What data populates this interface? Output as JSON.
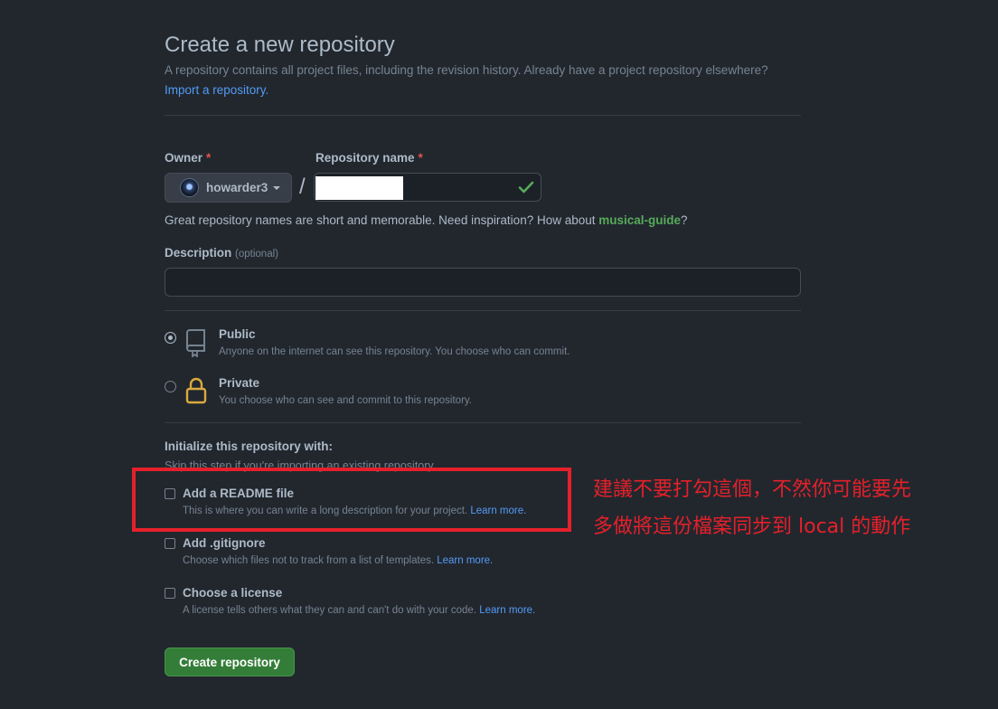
{
  "header": {
    "title": "Create a new repository",
    "subtitle": "A repository contains all project files, including the revision history. Already have a project repository elsewhere?",
    "import_link": "Import a repository."
  },
  "owner": {
    "label": "Owner",
    "required_mark": "*",
    "value": "howarder3"
  },
  "repo_name": {
    "label": "Repository name",
    "required_mark": "*",
    "separator": "/",
    "hint_prefix": "Great repository names are short and memorable. Need inspiration? How about ",
    "suggestion": "musical-guide",
    "hint_suffix": "?"
  },
  "description": {
    "label": "Description",
    "optional": "(optional)",
    "value": ""
  },
  "visibility": {
    "selected": "public",
    "options": [
      {
        "title": "Public",
        "desc": "Anyone on the internet can see this repository. You choose who can commit."
      },
      {
        "title": "Private",
        "desc": "You choose who can see and commit to this repository."
      }
    ]
  },
  "init": {
    "heading": "Initialize this repository with:",
    "subheading": "Skip this step if you're importing an existing repository.",
    "options": [
      {
        "title": "Add a README file",
        "desc": "This is where you can write a long description for your project.",
        "link": "Learn more."
      },
      {
        "title": "Add .gitignore",
        "desc": "Choose which files not to track from a list of templates.",
        "link": "Learn more."
      },
      {
        "title": "Choose a license",
        "desc": "A license tells others what they can and can't do with your code.",
        "link": "Learn more."
      }
    ]
  },
  "create_button": "Create repository",
  "annotation": {
    "line1": "建議不要打勾這個，不然你可能要先",
    "line2": "多做將這份檔案同步到 local 的動作"
  },
  "colors": {
    "background": "#22272e",
    "accent_green": "#347d39",
    "link_blue": "#539bf5",
    "annotation_red": "#e5202a"
  }
}
